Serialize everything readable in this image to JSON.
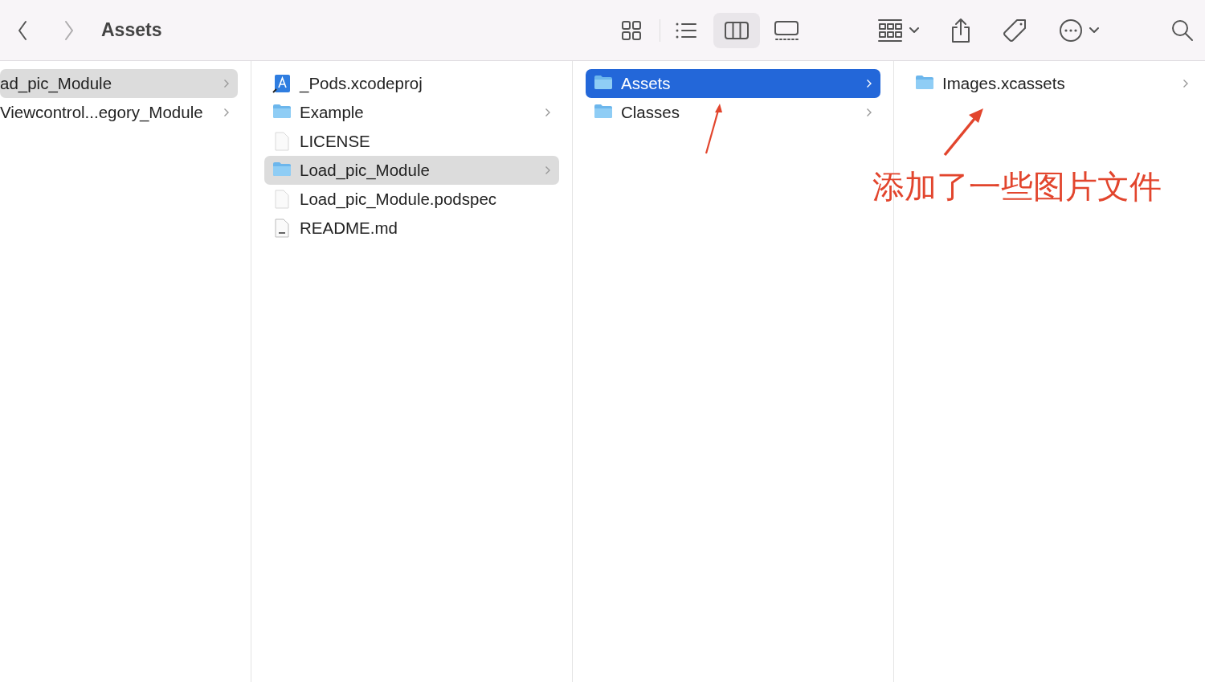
{
  "toolbar": {
    "back": {
      "disabled": false
    },
    "forward": {
      "disabled": true
    },
    "title": "Assets",
    "view_modes": [
      {
        "kind": "icons",
        "selected": false
      },
      {
        "kind": "list",
        "selected": false
      },
      {
        "kind": "columns",
        "selected": true
      },
      {
        "kind": "gallery",
        "selected": false
      }
    ]
  },
  "columns": [
    {
      "active": false,
      "items": [
        {
          "name": "ad_pic_Module",
          "expandable": true,
          "selected": true
        },
        {
          "name": "Viewcontrol...egory_Module",
          "expandable": true,
          "selected": false
        }
      ]
    },
    {
      "active": false,
      "items": [
        {
          "name": "_Pods.xcodeproj",
          "kind": "xcodeproj",
          "expandable": false,
          "selected": false
        },
        {
          "name": "Example",
          "kind": "folder",
          "expandable": true,
          "selected": false
        },
        {
          "name": "LICENSE",
          "kind": "file",
          "expandable": false,
          "selected": false
        },
        {
          "name": "Load_pic_Module",
          "kind": "folder",
          "expandable": true,
          "selected": true
        },
        {
          "name": "Load_pic_Module.podspec",
          "kind": "file",
          "expandable": false,
          "selected": false
        },
        {
          "name": "README.md",
          "kind": "markdown",
          "expandable": false,
          "selected": false
        }
      ]
    },
    {
      "active": true,
      "items": [
        {
          "name": "Assets",
          "kind": "folder",
          "expandable": true,
          "selected": true
        },
        {
          "name": "Classes",
          "kind": "folder",
          "expandable": true,
          "selected": false
        }
      ]
    },
    {
      "items": [
        {
          "name": "Images.xcassets",
          "kind": "folder",
          "expandable": true,
          "selected": false
        }
      ]
    }
  ],
  "annotation": {
    "text": "添加了一些图片文件"
  }
}
